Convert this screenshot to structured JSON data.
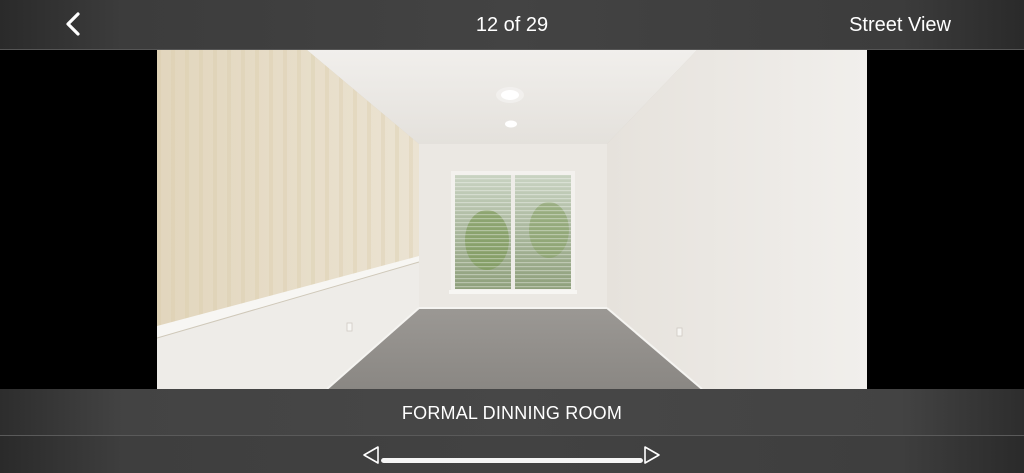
{
  "header": {
    "back_icon": "chevron-left-icon",
    "counter": "12 of 29",
    "street_view_label": "Street View"
  },
  "photo": {
    "caption": "FORMAL DINNING ROOM"
  },
  "scrubber": {
    "prev_icon": "triangle-left-icon",
    "next_icon": "triangle-right-icon",
    "progress": 1.0
  },
  "colors": {
    "bar": "#434343",
    "text": "#ffffff",
    "scrub_fill": "#f5f5f5"
  }
}
